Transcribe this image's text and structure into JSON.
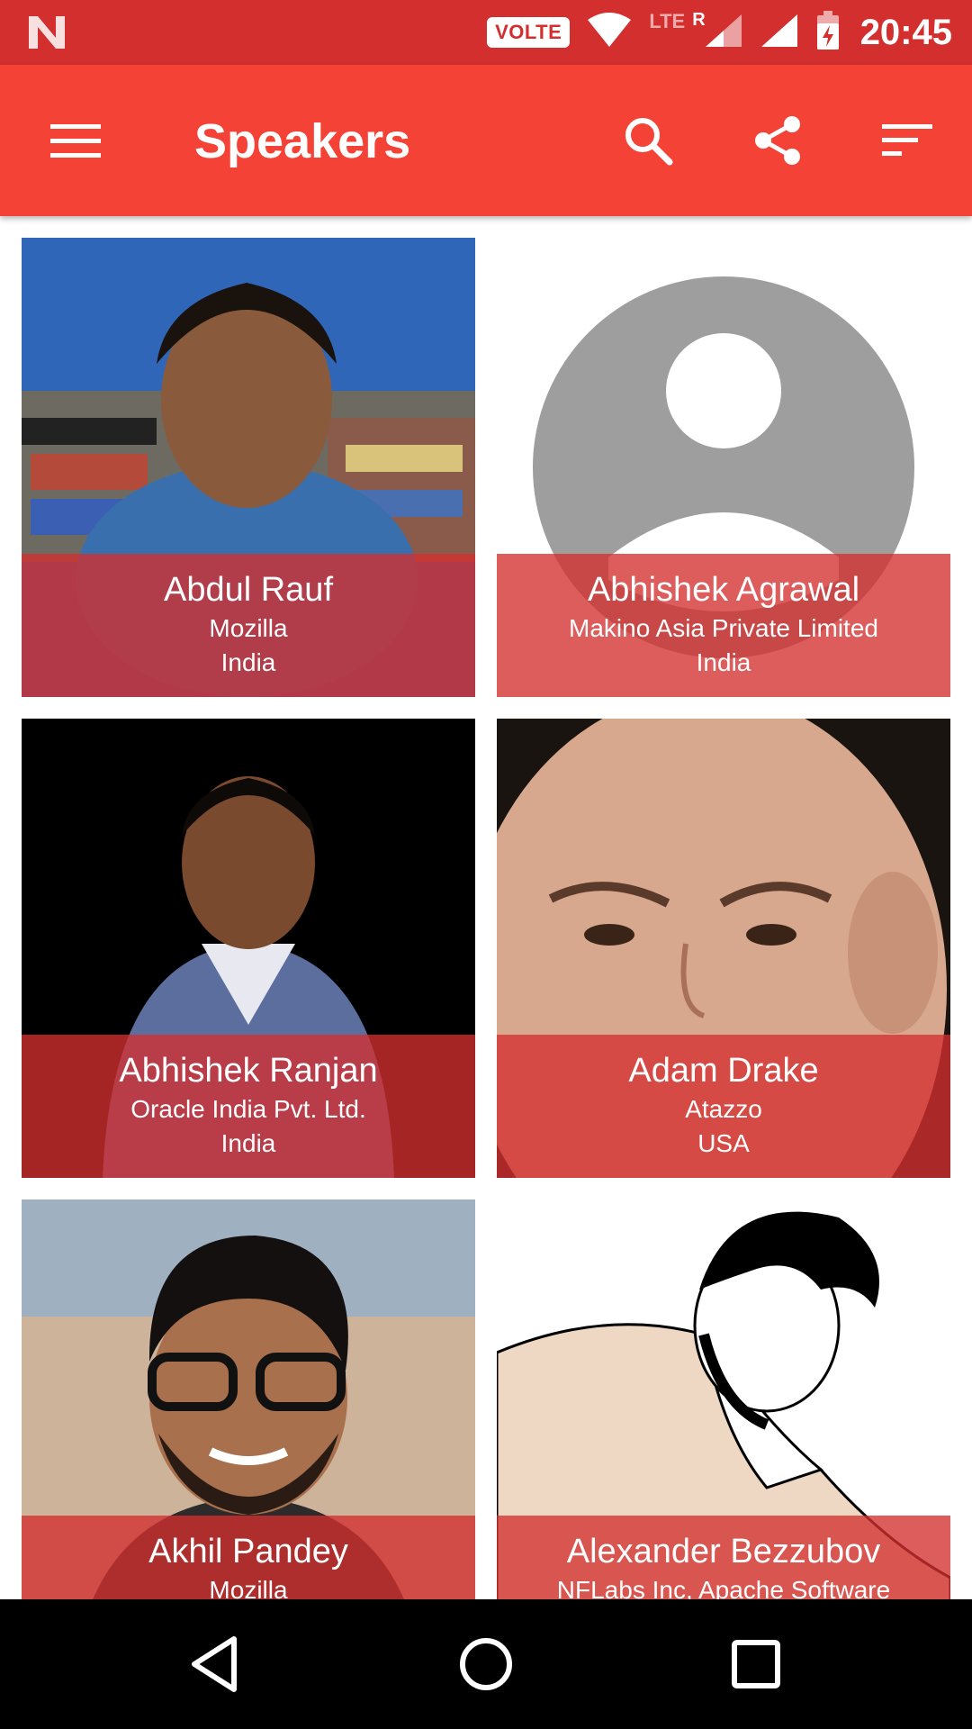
{
  "status_bar": {
    "badge": "VOLTE",
    "network": "LTE",
    "roaming": "R",
    "time": "20:45"
  },
  "app_bar": {
    "title": "Speakers"
  },
  "speakers": [
    {
      "name": "Abdul Rauf",
      "organisation": "Mozilla",
      "country": "India"
    },
    {
      "name": "Abhishek Agrawal",
      "organisation": "Makino Asia Private Limited",
      "country": "India"
    },
    {
      "name": "Abhishek Ranjan",
      "organisation": "Oracle India Pvt. Ltd.",
      "country": "India"
    },
    {
      "name": "Adam Drake",
      "organisation": "Atazzo",
      "country": "USA"
    },
    {
      "name": "Akhil Pandey",
      "organisation": "Mozilla",
      "country": ""
    },
    {
      "name": "Alexander Bezzubov",
      "organisation": "NFLabs Inc, Apache Software Foundation",
      "country": ""
    }
  ],
  "colors": {
    "status_bar": "#d32f2f",
    "app_bar": "#f44336",
    "card_overlay": "#d32f2f"
  }
}
